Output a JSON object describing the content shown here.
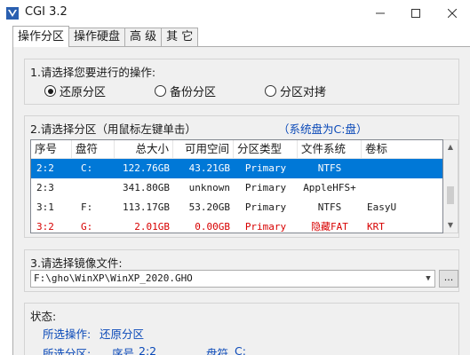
{
  "window": {
    "title": "CGI 3.2"
  },
  "tabs": [
    {
      "label": "操作分区"
    },
    {
      "label": "操作硬盘"
    },
    {
      "label": "高 级"
    },
    {
      "label": "其 它"
    }
  ],
  "step1": {
    "label": "1.请选择您要进行的操作:",
    "options": [
      {
        "label": "还原分区",
        "selected": true
      },
      {
        "label": "备份分区",
        "selected": false
      },
      {
        "label": "分区对拷",
        "selected": false
      }
    ]
  },
  "step2": {
    "label": "2.请选择分区（用鼠标左键单击）",
    "system_disk": "（系统盘为C:盘）",
    "columns": [
      "序号",
      "盘符",
      "总大小",
      "可用空间",
      "分区类型",
      "文件系统",
      "卷标"
    ],
    "rows": [
      [
        "2:2",
        "C:",
        "122.76GB",
        "43.21GB",
        "Primary",
        "NTFS",
        ""
      ],
      [
        "2:3",
        "",
        "341.80GB",
        "unknown",
        "Primary",
        "AppleHFS+",
        ""
      ],
      [
        "3:1",
        "F:",
        "113.17GB",
        "53.20GB",
        "Primary",
        "NTFS",
        "EasyU"
      ],
      [
        "3:2",
        "G:",
        "2.01GB",
        "0.00GB",
        "Primary",
        "隐藏FAT",
        "KRT"
      ]
    ],
    "selected_row": 0,
    "red_row": 3
  },
  "step3": {
    "label": "3.请选择镜像文件:",
    "image_path": "F:\\gho\\WinXP\\WinXP_2020.GHO",
    "browse_label": "..."
  },
  "status": {
    "label": "状态:",
    "operation_label": "所选操作:",
    "operation_value": "还原分区",
    "partition_label": "所选分区:",
    "partition_index_label": "序号",
    "partition_index_value": "2:2",
    "partition_drive_label": "盘符",
    "partition_drive_value": "C:"
  },
  "colors": {
    "selection": "#0078d7",
    "link_blue": "#0a49b8",
    "warning_red": "#d80000"
  }
}
